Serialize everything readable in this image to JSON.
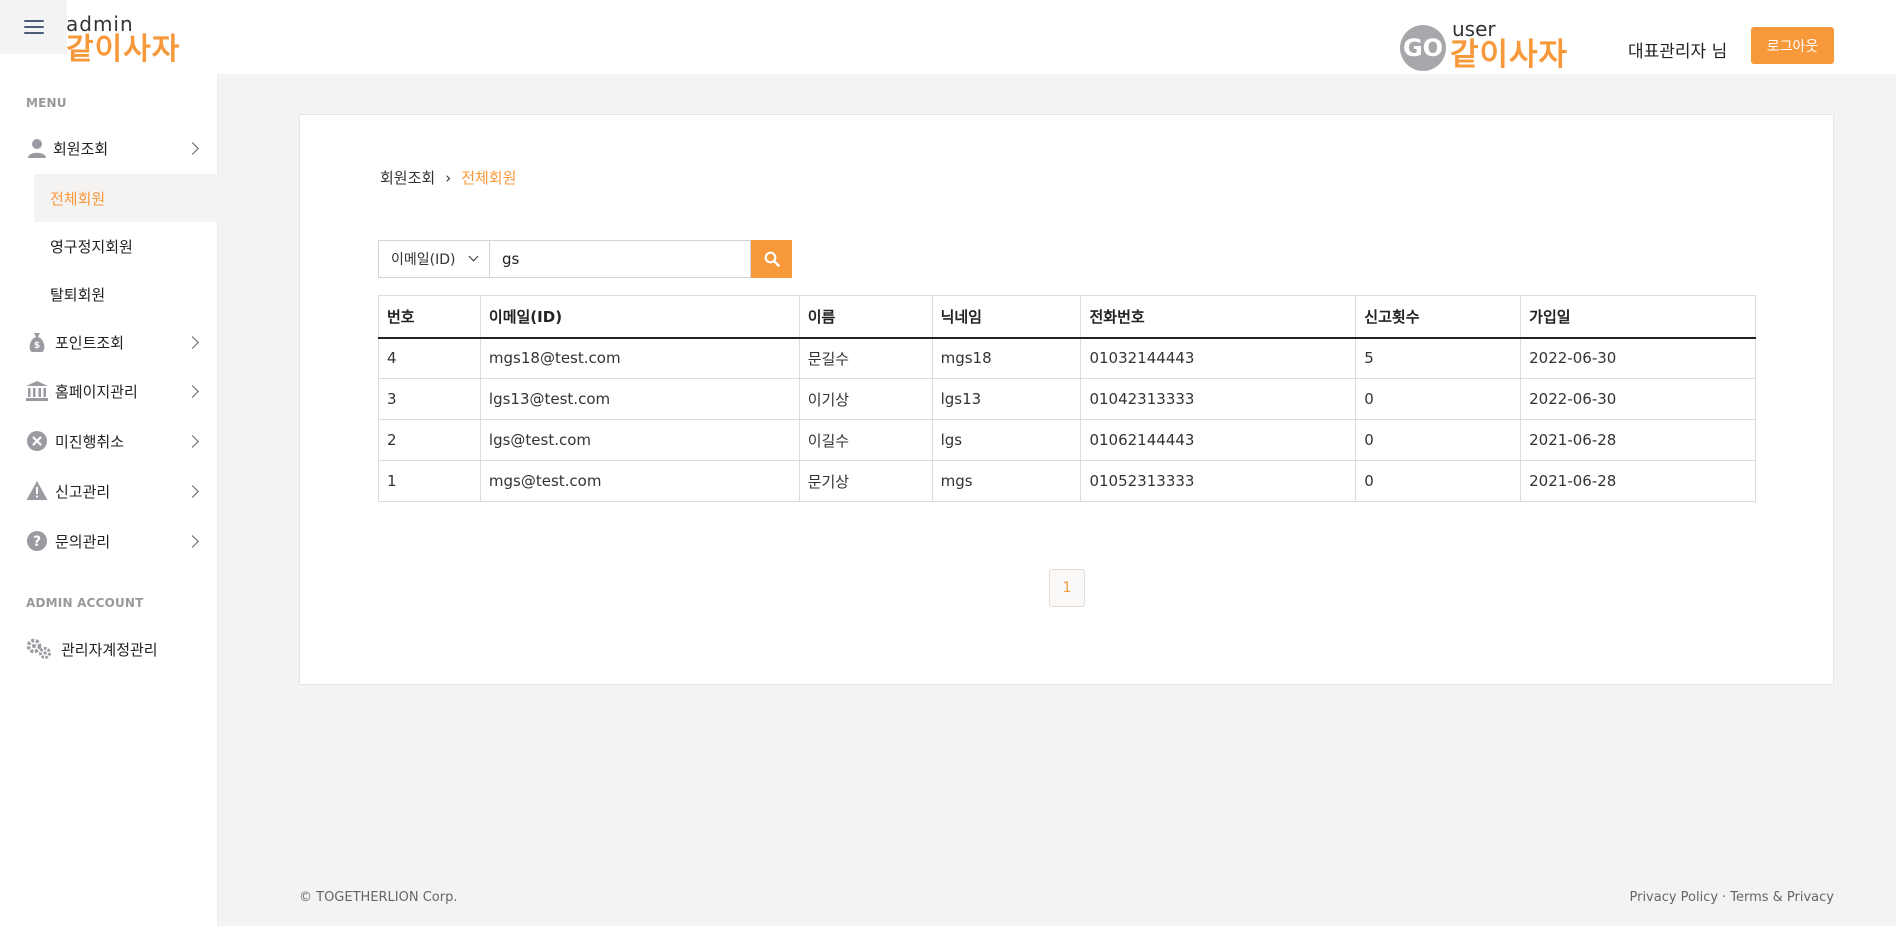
{
  "header": {
    "admin_logo_small": "admin",
    "admin_logo_big": "같이사자",
    "user_logo_go": "GO",
    "user_logo_small": "user",
    "user_logo_big": "같이사자",
    "admin_name": "대표관리자 님",
    "logout_label": "로그아웃"
  },
  "sidebar": {
    "menu_section": "MENU",
    "items": [
      {
        "label": "회원조회",
        "icon": "user-icon"
      },
      {
        "label": "포인트조회",
        "icon": "money-bag-icon"
      },
      {
        "label": "홈페이지관리",
        "icon": "bank-icon"
      },
      {
        "label": "미진행취소",
        "icon": "cancel-circle-icon"
      },
      {
        "label": "신고관리",
        "icon": "warning-icon"
      },
      {
        "label": "문의관리",
        "icon": "question-circle-icon"
      }
    ],
    "sub_items": [
      {
        "label": "전체회원",
        "active": true
      },
      {
        "label": "영구정지회원",
        "active": false
      },
      {
        "label": "탈퇴회원",
        "active": false
      }
    ],
    "account_section": "ADMIN ACCOUNT",
    "account_item": {
      "label": "관리자계정관리",
      "icon": "gears-icon"
    }
  },
  "breadcrumb": {
    "parent": "회원조회",
    "separator": "›",
    "current": "전체회원"
  },
  "search": {
    "field_selected": "이메일(ID)",
    "value": "gs"
  },
  "table": {
    "headers": [
      "번호",
      "이메일(ID)",
      "이름",
      "닉네임",
      "전화번호",
      "신고횟수",
      "가입일"
    ],
    "rows": [
      [
        "4",
        "mgs18@test.com",
        "문길수",
        "mgs18",
        "01032144443",
        "5",
        "2022-06-30"
      ],
      [
        "3",
        "lgs13@test.com",
        "이기상",
        "lgs13",
        "01042313333",
        "0",
        "2022-06-30"
      ],
      [
        "2",
        "lgs@test.com",
        "이길수",
        "lgs",
        "01062144443",
        "0",
        "2021-06-28"
      ],
      [
        "1",
        "mgs@test.com",
        "문기상",
        "mgs",
        "01052313333",
        "0",
        "2021-06-28"
      ]
    ]
  },
  "pagination": {
    "current_page": "1"
  },
  "footer": {
    "copyright": "© TOGETHERLION Corp.",
    "privacy": "Privacy Policy",
    "dot": "·",
    "terms": "Terms & Privacy"
  },
  "colors": {
    "accent": "#f7993a",
    "background": "#f3f3f6"
  }
}
